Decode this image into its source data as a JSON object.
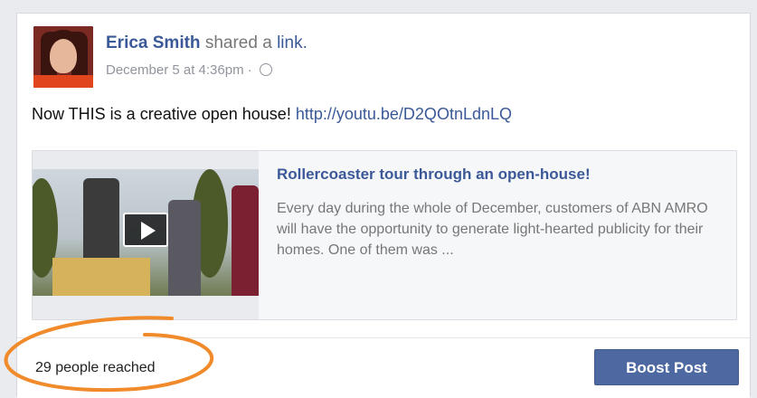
{
  "post": {
    "author": "Erica Smith",
    "action_prefix": "shared a",
    "action_link": "link",
    "action_suffix": ".",
    "timestamp": "December 5 at 4:36pm",
    "separator": "·",
    "text": "Now THIS is a creative open house!",
    "url": "http://youtu.be/D2QOtnLdnLQ"
  },
  "link_preview": {
    "title": "Rollercoaster tour through an open-house!",
    "description": "Every day during the whole of December, customers of ABN AMRO will have the opportunity to generate light-hearted publicity for their homes. One of them was ..."
  },
  "footer": {
    "reach_text": "29 people reached",
    "boost_label": "Boost Post"
  },
  "icons": {
    "privacy": "globe-icon",
    "video": "play-icon"
  },
  "colors": {
    "link_blue": "#3b5998",
    "boost_button": "#4e69a2",
    "annotation": "#f08a2a"
  }
}
